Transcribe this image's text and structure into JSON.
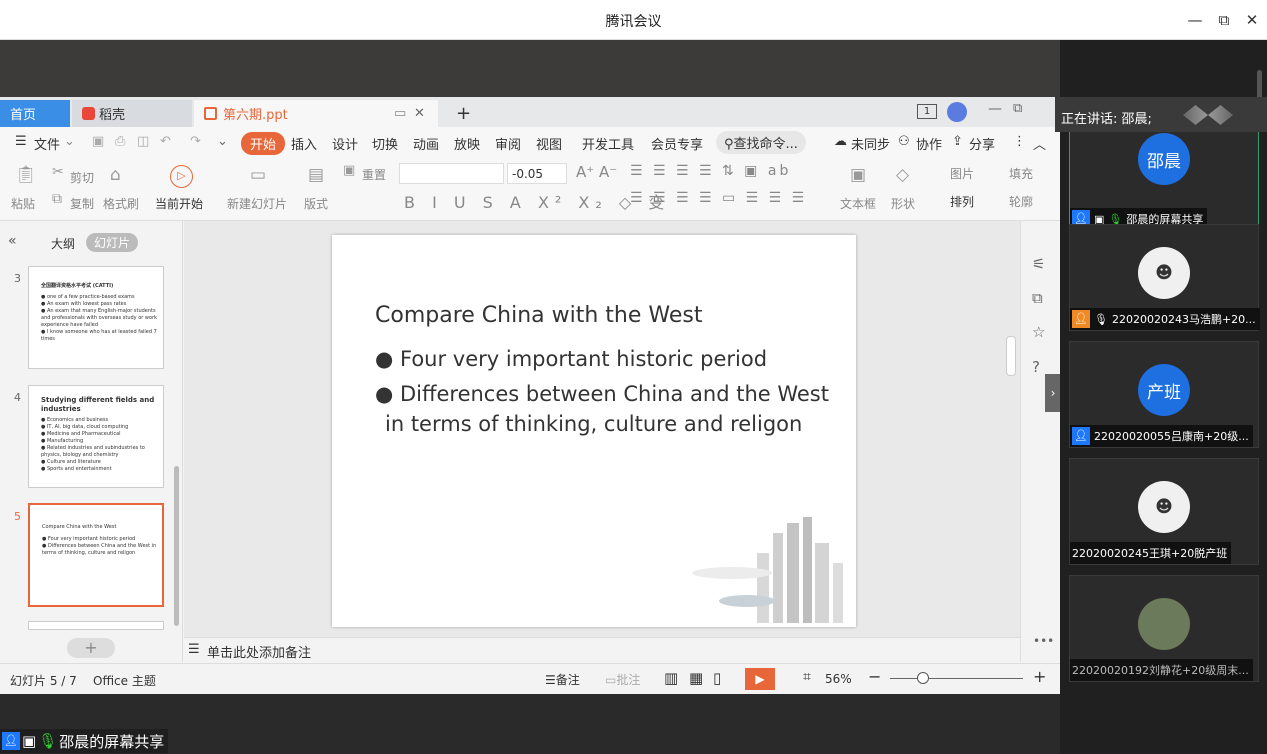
{
  "window": {
    "title": "腾讯会议",
    "minimize": "—",
    "restore": "⧉",
    "close": "✕"
  },
  "wps": {
    "tabs": {
      "home": "首页",
      "docer": "稻壳",
      "file": "第六期.ppt",
      "new": "+"
    },
    "menu": [
      "文件",
      "开始",
      "插入",
      "设计",
      "切换",
      "动画",
      "放映",
      "审阅",
      "视图",
      "开发工具",
      "会员专享"
    ],
    "search": "查找命令...",
    "sync": "未同步",
    "collab": "协作",
    "share": "分享",
    "ribbon": {
      "paste": "粘贴",
      "cut": "剪切",
      "copy": "复制",
      "format_painter": "格式刷",
      "start_current": "当前开始",
      "new_slide": "新建幻灯片",
      "layout": "版式",
      "reset": "重置",
      "font_size": "-0.05",
      "textbox": "文本框",
      "shape": "形状",
      "arrange": "排列",
      "picture": "图片",
      "fill": "填充",
      "outline": "轮廓"
    },
    "leftpane": {
      "outline_tab": "大纲",
      "slides_tab": "幻灯片"
    },
    "thumbs": [
      {
        "num": "3",
        "title": "全国翻译资格水平考试 (CATTI)",
        "bullets": [
          "one of a few practice-based exams",
          "An exam with lowest pass rates",
          "An exam that many English-major students and professionals with overseas study or work experience have failed",
          "I know someone who has at leasted failed 7 times"
        ]
      },
      {
        "num": "4",
        "title": "Studying different fields and industries",
        "bullets": [
          "Economics and business",
          "IT, AI, big data, cloud computing",
          "Medicine and Pharmaceutical",
          "Manufacturing",
          "Related industries and subindustries to physics, biology and chemistry",
          "Culture and literature",
          "Sports and entertainment"
        ]
      },
      {
        "num": "5",
        "title": "Compare China with the West",
        "bullets": [
          "Four very important historic period",
          "Differences between China and the West in terms of thinking, culture and religon"
        ]
      }
    ],
    "slide": {
      "title": "Compare China with the West",
      "bullet1": "Four very important historic period",
      "bullet2_line1": "Differences between China and the West",
      "bullet2_line2": "in terms of thinking, culture and religon"
    },
    "notes_placeholder": "单击此处添加备注",
    "status": {
      "slide_info": "幻灯片 5 / 7",
      "theme": "Office 主题",
      "notes": "备注",
      "comment": "批注",
      "zoom": "56%"
    }
  },
  "meeting": {
    "speaking": "正在讲话: 邵晨;",
    "share_label": "邵晨的屏幕共享",
    "participants": [
      {
        "avatar_text": "邵晨",
        "name": "邵晨的屏幕共享",
        "color": "#1e6fe0"
      },
      {
        "avatar_text": "",
        "name": "22020020243马浩鹏+20...",
        "color": "#f0f0f0"
      },
      {
        "avatar_text": "产班",
        "name": "22020020055吕康南+20级...",
        "color": "#1e6fe0"
      },
      {
        "avatar_text": "",
        "name": "22020020245王琪+20脱产班",
        "color": "#f0f0f0"
      },
      {
        "avatar_text": "",
        "name": "22020020192刘静花+20级周末...",
        "color": "#6b7a5a"
      }
    ]
  }
}
